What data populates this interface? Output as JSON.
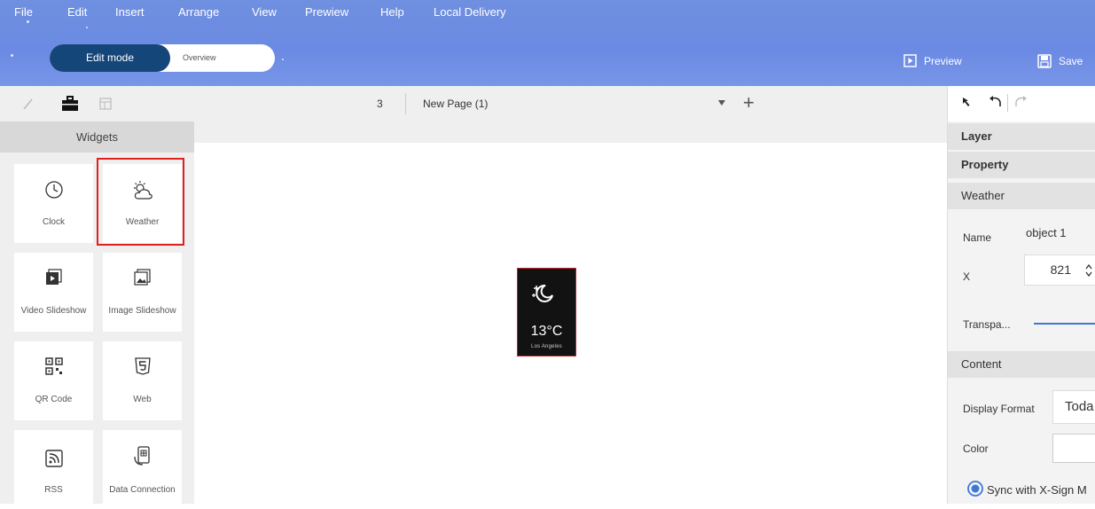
{
  "menu": [
    "File",
    "Edit",
    "Insert",
    "Arrange",
    "View",
    "Prewiew",
    "Help",
    "Local Delivery"
  ],
  "mode": {
    "edit_label": "Edit mode",
    "overview_label": "Overview"
  },
  "top_actions": {
    "preview": "Preview",
    "save": "Save"
  },
  "left_panel": {
    "header": "Widgets",
    "widgets": [
      {
        "label": "Clock",
        "icon": "clock-icon"
      },
      {
        "label": "Weather",
        "icon": "weather-icon",
        "highlighted": true
      },
      {
        "label": "Video Slideshow",
        "icon": "video-slideshow-icon"
      },
      {
        "label": "Image Slideshow",
        "icon": "image-slideshow-icon"
      },
      {
        "label": "QR Code",
        "icon": "qr-code-icon"
      },
      {
        "label": "Web",
        "icon": "html5-icon"
      },
      {
        "label": "RSS",
        "icon": "rss-icon"
      },
      {
        "label": "Data Connection",
        "icon": "data-connection-icon"
      }
    ]
  },
  "page_bar": {
    "page_number": "3",
    "page_name": "New Page (1)"
  },
  "weather_widget": {
    "temperature": "13°C",
    "city": "Los Angeles"
  },
  "right_panel": {
    "layer": "Layer",
    "property": "Property",
    "weather_section": "Weather",
    "name_label": "Name",
    "name_value": "object 1",
    "x_label": "X",
    "x_value": "821",
    "transparency_label": "Transpa...",
    "content_section": "Content",
    "display_format_label": "Display Format",
    "display_format_value": "Toda",
    "color_label": "Color",
    "sync_label": "Sync with X-Sign M"
  },
  "colors": {
    "topbar": "#6b8ae3",
    "edit_mode": "#15467a",
    "highlight": "#e02020",
    "accent": "#3d78d8"
  }
}
